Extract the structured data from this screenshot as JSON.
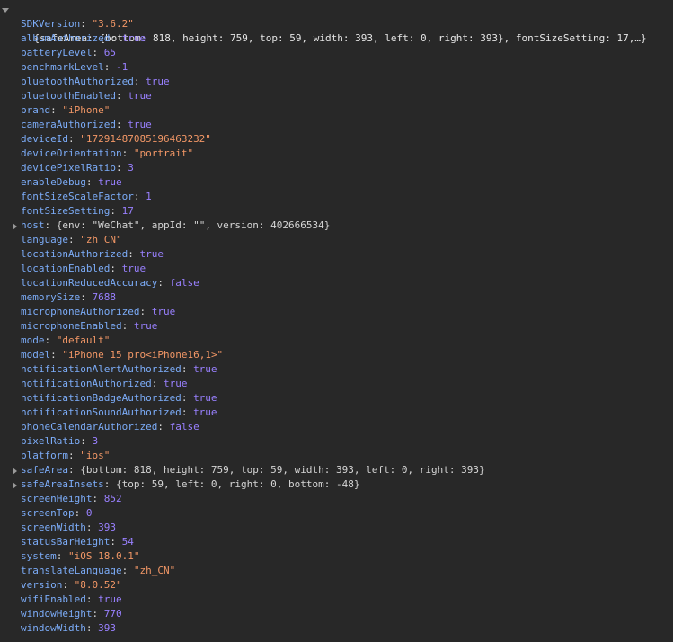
{
  "console": {
    "header_summary": "{safeArea: {bottom: 818, height: 759, top: 59, width: 393, left: 0, right: 393}, fontSizeSetting: 17,…}",
    "properties": [
      {
        "key": "SDKVersion",
        "type": "string",
        "value": "\"3.6.2\""
      },
      {
        "key": "albumAuthorized",
        "type": "bool",
        "value": "true"
      },
      {
        "key": "batteryLevel",
        "type": "number",
        "value": "65"
      },
      {
        "key": "benchmarkLevel",
        "type": "number",
        "value": "-1"
      },
      {
        "key": "bluetoothAuthorized",
        "type": "bool",
        "value": "true"
      },
      {
        "key": "bluetoothEnabled",
        "type": "bool",
        "value": "true"
      },
      {
        "key": "brand",
        "type": "string",
        "value": "\"iPhone\""
      },
      {
        "key": "cameraAuthorized",
        "type": "bool",
        "value": "true"
      },
      {
        "key": "deviceId",
        "type": "string",
        "value": "\"17291487085196463232\""
      },
      {
        "key": "deviceOrientation",
        "type": "string",
        "value": "\"portrait\""
      },
      {
        "key": "devicePixelRatio",
        "type": "number",
        "value": "3"
      },
      {
        "key": "enableDebug",
        "type": "bool",
        "value": "true"
      },
      {
        "key": "fontSizeScaleFactor",
        "type": "number",
        "value": "1"
      },
      {
        "key": "fontSizeSetting",
        "type": "number",
        "value": "17"
      },
      {
        "key": "host",
        "type": "object",
        "value": "{env: \"WeChat\", appId: \"\", version: 402666534}"
      },
      {
        "key": "language",
        "type": "string",
        "value": "\"zh_CN\""
      },
      {
        "key": "locationAuthorized",
        "type": "bool",
        "value": "true"
      },
      {
        "key": "locationEnabled",
        "type": "bool",
        "value": "true"
      },
      {
        "key": "locationReducedAccuracy",
        "type": "bool",
        "value": "false"
      },
      {
        "key": "memorySize",
        "type": "number",
        "value": "7688"
      },
      {
        "key": "microphoneAuthorized",
        "type": "bool",
        "value": "true"
      },
      {
        "key": "microphoneEnabled",
        "type": "bool",
        "value": "true"
      },
      {
        "key": "mode",
        "type": "string",
        "value": "\"default\""
      },
      {
        "key": "model",
        "type": "string",
        "value": "\"iPhone 15 pro<iPhone16,1>\""
      },
      {
        "key": "notificationAlertAuthorized",
        "type": "bool",
        "value": "true"
      },
      {
        "key": "notificationAuthorized",
        "type": "bool",
        "value": "true"
      },
      {
        "key": "notificationBadgeAuthorized",
        "type": "bool",
        "value": "true"
      },
      {
        "key": "notificationSoundAuthorized",
        "type": "bool",
        "value": "true"
      },
      {
        "key": "phoneCalendarAuthorized",
        "type": "bool",
        "value": "false"
      },
      {
        "key": "pixelRatio",
        "type": "number",
        "value": "3"
      },
      {
        "key": "platform",
        "type": "string",
        "value": "\"ios\""
      },
      {
        "key": "safeArea",
        "type": "object",
        "value": "{bottom: 818, height: 759, top: 59, width: 393, left: 0, right: 393}"
      },
      {
        "key": "safeAreaInsets",
        "type": "object",
        "value": "{top: 59, left: 0, right: 0, bottom: -48}"
      },
      {
        "key": "screenHeight",
        "type": "number",
        "value": "852"
      },
      {
        "key": "screenTop",
        "type": "number",
        "value": "0"
      },
      {
        "key": "screenWidth",
        "type": "number",
        "value": "393"
      },
      {
        "key": "statusBarHeight",
        "type": "number",
        "value": "54"
      },
      {
        "key": "system",
        "type": "string",
        "value": "\"iOS 18.0.1\""
      },
      {
        "key": "translateLanguage",
        "type": "string",
        "value": "\"zh_CN\""
      },
      {
        "key": "version",
        "type": "string",
        "value": "\"8.0.52\""
      },
      {
        "key": "wifiEnabled",
        "type": "bool",
        "value": "true"
      },
      {
        "key": "windowHeight",
        "type": "number",
        "value": "770"
      },
      {
        "key": "windowWidth",
        "type": "number",
        "value": "393"
      }
    ]
  },
  "colors": {
    "background": "#282828",
    "key": "#7cacf8",
    "string": "#f29766",
    "number": "#9980ff",
    "text": "#d5d5d5"
  }
}
